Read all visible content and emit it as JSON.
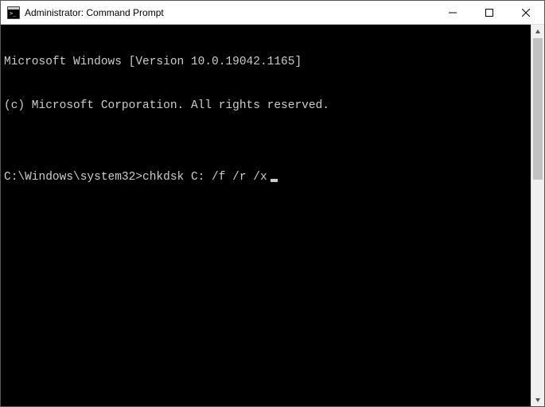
{
  "window": {
    "title": "Administrator: Command Prompt"
  },
  "terminal": {
    "line1": "Microsoft Windows [Version 10.0.19042.1165]",
    "line2": "(c) Microsoft Corporation. All rights reserved.",
    "blank": "",
    "prompt": "C:\\Windows\\system32>",
    "command": "chkdsk C: /f /r /x"
  }
}
